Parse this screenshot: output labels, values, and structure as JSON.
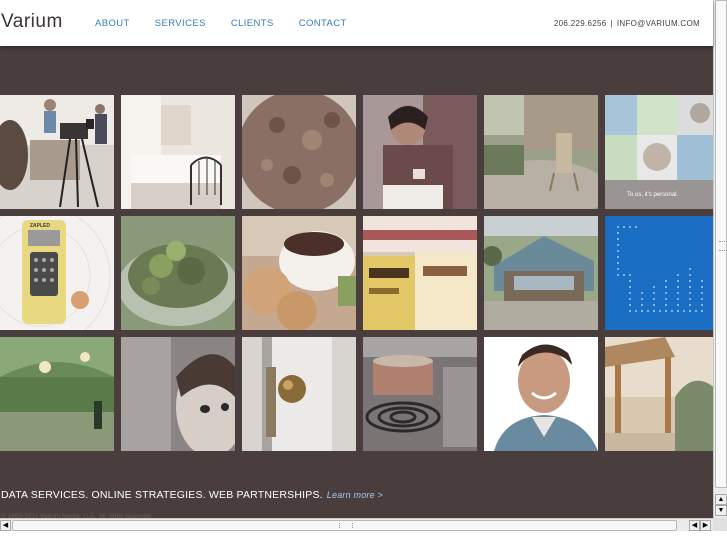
{
  "header": {
    "logo": "Varium",
    "nav": [
      "ABOUT",
      "SERVICES",
      "CLIENTS",
      "CONTACT"
    ],
    "phone": "206.229.6256",
    "separator": "|",
    "email": "INFO@VARIUM.COM"
  },
  "tiles": {
    "personal_caption": "To us, it's personal.",
    "device_label": "ZAPLED"
  },
  "footer": {
    "tagline": "DATA SERVICES. ONLINE STRATEGIES. WEB PARTNERSHIPS.",
    "learn_more": "Learn more >",
    "copyright": "© 1999-2011 Varium Media, LLC. All rights reserved."
  },
  "colors": {
    "background": "#4a3d3d",
    "nav_link": "#3a7cbc",
    "accent_blue": "#1a6fc4"
  }
}
